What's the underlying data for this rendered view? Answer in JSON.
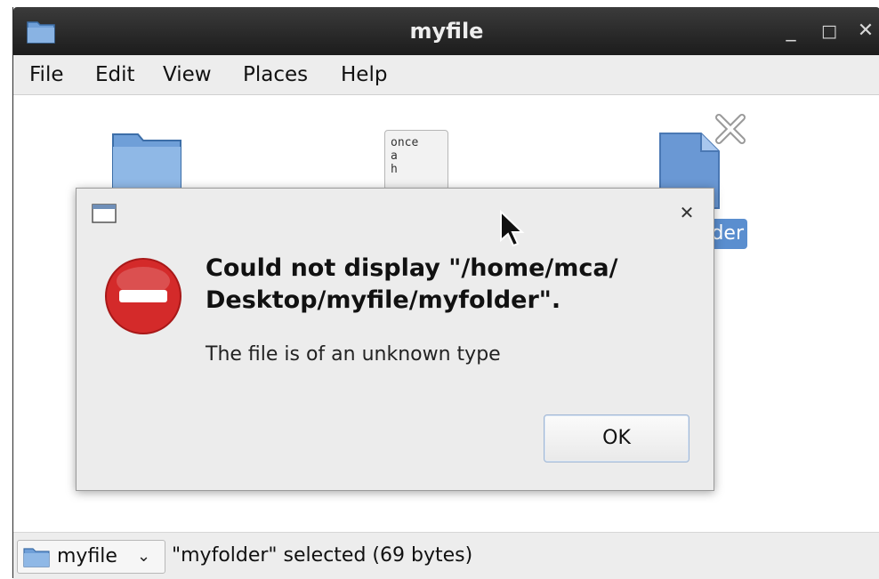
{
  "window": {
    "title": "myfile",
    "controls": {
      "minimize": "_",
      "maximize": "□",
      "close": "✕"
    }
  },
  "menubar": {
    "items": [
      "File",
      "Edit",
      "View",
      "Places",
      "Help"
    ]
  },
  "files": {
    "text_file_preview": [
      "once",
      "a",
      "h"
    ],
    "selected_label": "der"
  },
  "dialog": {
    "close": "✕",
    "heading": "Could not display \"/home/mca/\nDesktop/myfile/myfolder\".",
    "message": "The file is of an unknown type",
    "ok_label": "OK"
  },
  "statusbar": {
    "location": "myfile",
    "chevron": "⌄",
    "status": "\"myfolder\" selected (69 bytes)"
  },
  "colors": {
    "titlebar": "#2a2a2a",
    "selection": "#5a8ecf",
    "folder": "#6f9fd8",
    "error": "#d42a2a"
  }
}
